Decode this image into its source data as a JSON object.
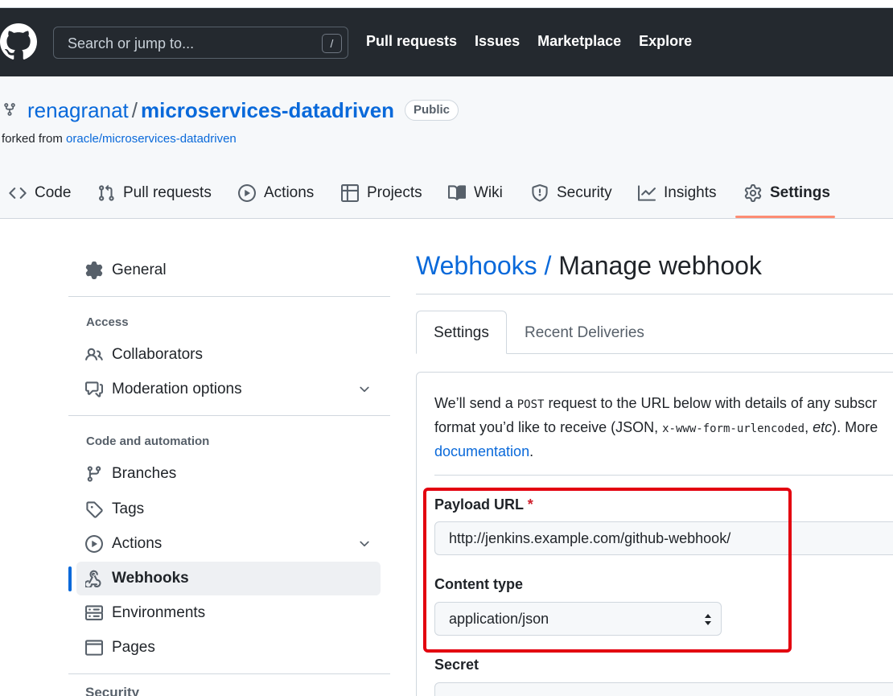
{
  "header": {
    "search_placeholder": "Search or jump to...",
    "search_shortcut": "/",
    "nav": [
      "Pull requests",
      "Issues",
      "Marketplace",
      "Explore"
    ]
  },
  "repo": {
    "owner": "renagranat",
    "separator": "/",
    "name": "microservices-datadriven",
    "visibility": "Public",
    "forked_prefix": "forked from",
    "forked_from": "oracle/microservices-datadriven"
  },
  "repo_tabs": [
    "Code",
    "Pull requests",
    "Actions",
    "Projects",
    "Wiki",
    "Security",
    "Insights",
    "Settings"
  ],
  "sidebar": {
    "general": "General",
    "access_heading": "Access",
    "collaborators": "Collaborators",
    "moderation": "Moderation options",
    "code_heading": "Code and automation",
    "branches": "Branches",
    "tags": "Tags",
    "actions": "Actions",
    "webhooks": "Webhooks",
    "environments": "Environments",
    "pages": "Pages",
    "next_heading": "Security"
  },
  "main": {
    "title_link": "Webhooks /",
    "title_rest": "Manage webhook",
    "tab_settings": "Settings",
    "tab_recent": "Recent Deliveries",
    "desc_1a": "We’ll send a ",
    "desc_post": "POST",
    "desc_1b": " request to the URL below with details of any subscr",
    "desc_2a": "format you’d like to receive (JSON, ",
    "desc_code2": "x-www-form-urlencoded",
    "desc_2b": ", ",
    "desc_etc": "etc",
    "desc_2c": "). More",
    "desc_doc": "documentation",
    "desc_end": ".",
    "payload_label": "Payload URL",
    "required_mark": "*",
    "payload_value": "http://jenkins.example.com/github-webhook/",
    "content_type_label": "Content type",
    "content_type_value": "application/json",
    "secret_label": "Secret"
  },
  "colors": {
    "header_bg": "#24292f",
    "link": "#0969da",
    "active_tab_underline": "#fd8c73",
    "highlight": "#e3000f"
  }
}
